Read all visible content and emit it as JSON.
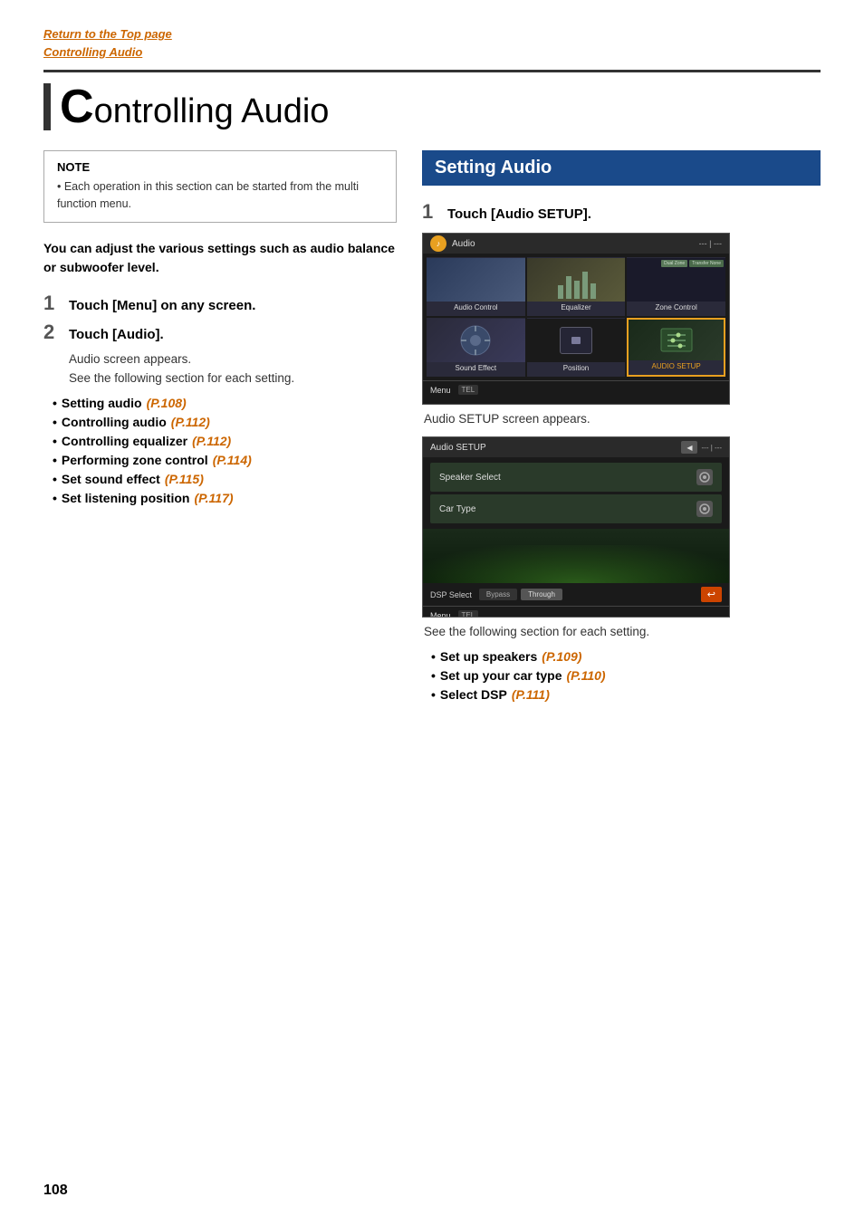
{
  "breadcrumb": {
    "return_link": "Return to the Top page",
    "current_link": "Controlling Audio"
  },
  "page_title": {
    "first_letter": "C",
    "rest": "ontrolling Audio"
  },
  "left": {
    "note": {
      "title": "NOTE",
      "text": "• Each operation in this section can be started from the multi function menu."
    },
    "intro": "You can adjust the various settings such as audio balance or subwoofer level.",
    "steps": [
      {
        "number": "1",
        "label": "Touch [Menu] on any screen."
      },
      {
        "number": "2",
        "label": "Touch [Audio].",
        "sub1": "Audio screen appears.",
        "sub2": "See the following section for each setting."
      }
    ],
    "bullets": [
      {
        "text": "Setting audio",
        "link": "(P.108)"
      },
      {
        "text": "Controlling audio",
        "link": "(P.112)"
      },
      {
        "text": "Controlling equalizer",
        "link": "(P.112)"
      },
      {
        "text": "Performing zone control",
        "link": "(P.114)"
      },
      {
        "text": "Set sound effect",
        "link": "(P.115)"
      },
      {
        "text": "Set listening position",
        "link": "(P.117)"
      }
    ]
  },
  "right": {
    "section_title": "Setting Audio",
    "step1_label": "Touch [Audio SETUP].",
    "screen1_caption": "Audio SETUP screen appears.",
    "screen1": {
      "top_icon": "♪",
      "top_label": "Audio",
      "top_right": "--- | ---",
      "cells": [
        {
          "label": "Audio Control",
          "highlighted": false
        },
        {
          "label": "Equalizer",
          "highlighted": false
        },
        {
          "label": "Zone Control",
          "highlighted": false
        },
        {
          "label": "Sound Effect",
          "highlighted": false
        },
        {
          "label": "Position",
          "highlighted": false
        },
        {
          "label": "AUDIO SETUP",
          "highlighted": true
        }
      ],
      "menu_label": "Menu",
      "tel_label": "TEL"
    },
    "screen2": {
      "title": "Audio SETUP",
      "row1": "Speaker Select",
      "row2": "Car Type",
      "dsp_label": "DSP Select",
      "bypass_label": "Bypass",
      "through_label": "Through",
      "menu_label": "Menu",
      "tel_label": "TEL"
    },
    "following_text": "See the following section for each setting.",
    "bullets": [
      {
        "text": "Set up speakers",
        "link": "(P.109)"
      },
      {
        "text": "Set up your car type",
        "link": "(P.110)"
      },
      {
        "text": "Select DSP",
        "link": "  (P.111)"
      }
    ]
  },
  "page_number": "108"
}
